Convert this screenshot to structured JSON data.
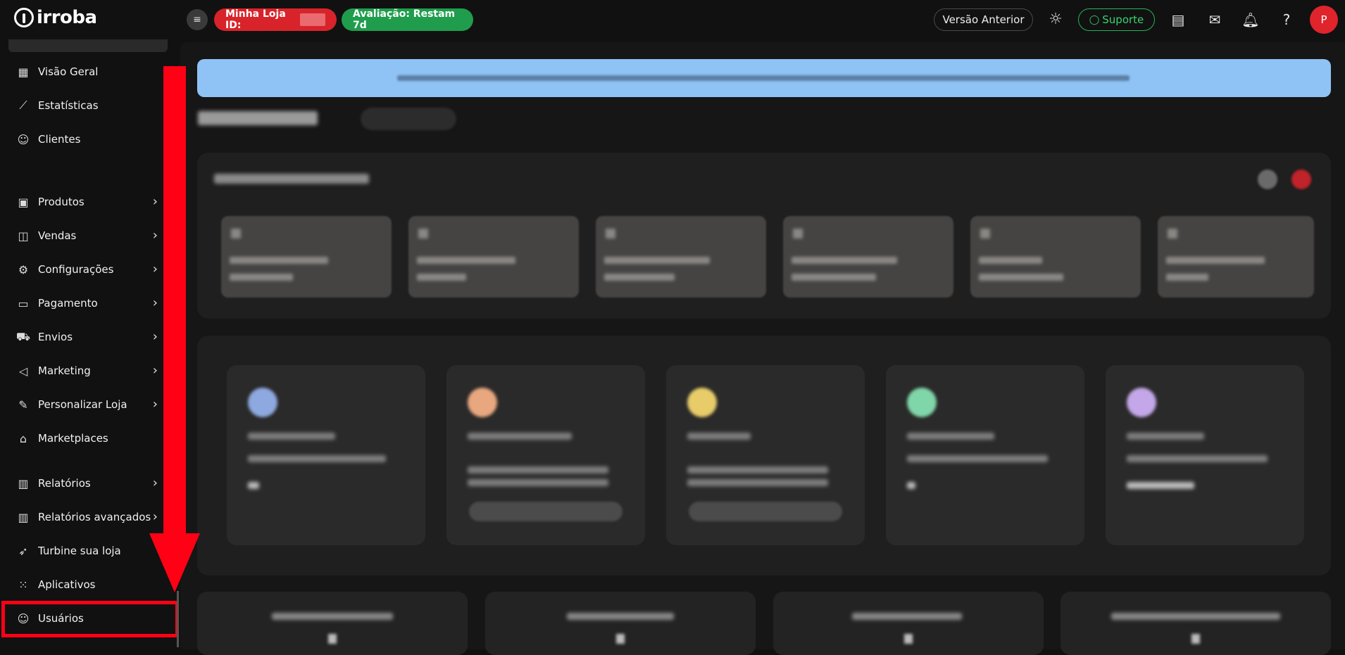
{
  "brand": {
    "name": "irroba"
  },
  "topbar": {
    "store_label": "Minha Loja ID:",
    "trial_label": "Avaliação: Restam 7d",
    "previous_version": "Versão Anterior",
    "support_label": "Suporte",
    "avatar_initial": "P"
  },
  "sidebar": {
    "items": [
      {
        "label": "Visão Geral",
        "icon": "layout-icon",
        "has_submenu": false
      },
      {
        "label": "Estatísticas",
        "icon": "chart-line-icon",
        "has_submenu": false
      },
      {
        "label": "Clientes",
        "icon": "users-icon",
        "has_submenu": false
      },
      {
        "label": "Produtos",
        "icon": "box-icon",
        "has_submenu": true
      },
      {
        "label": "Vendas",
        "icon": "shopping-bag-icon",
        "has_submenu": true
      },
      {
        "label": "Configurações",
        "icon": "gear-icon",
        "has_submenu": true
      },
      {
        "label": "Pagamento",
        "icon": "credit-card-icon",
        "has_submenu": true
      },
      {
        "label": "Envios",
        "icon": "truck-icon",
        "has_submenu": true
      },
      {
        "label": "Marketing",
        "icon": "megaphone-icon",
        "has_submenu": true
      },
      {
        "label": "Personalizar Loja",
        "icon": "brush-icon",
        "has_submenu": true
      },
      {
        "label": "Marketplaces",
        "icon": "store-icon",
        "has_submenu": false
      },
      {
        "label": "Relatórios",
        "icon": "report-icon",
        "has_submenu": true
      },
      {
        "label": "Relatórios avançados",
        "icon": "report-advanced-icon",
        "has_submenu": true
      },
      {
        "label": "Turbine sua loja",
        "icon": "rocket-icon",
        "has_submenu": false
      },
      {
        "label": "Aplicativos",
        "icon": "apps-grid-icon",
        "has_submenu": false
      },
      {
        "label": "Usuários",
        "icon": "users-icon",
        "has_submenu": false,
        "highlighted": true
      }
    ]
  },
  "colors": {
    "accent_red": "#d8232a",
    "accent_green": "#1f9d4d",
    "highlight": "#ff0015",
    "banner": "#8fc3f5"
  }
}
